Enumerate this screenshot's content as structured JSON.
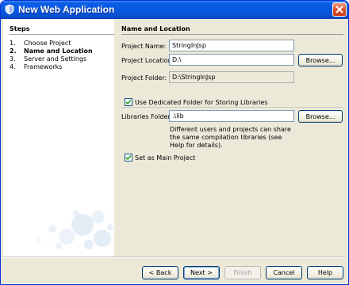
{
  "window": {
    "title": "New Web Application"
  },
  "steps": {
    "heading": "Steps",
    "items": [
      {
        "num": "1.",
        "label": "Choose Project"
      },
      {
        "num": "2.",
        "label": "Name and Location"
      },
      {
        "num": "3.",
        "label": "Server and Settings"
      },
      {
        "num": "4.",
        "label": "Frameworks"
      }
    ],
    "active_index": 1
  },
  "form": {
    "heading": "Name and Location",
    "project_name": {
      "label": "Project Name:",
      "value": "StringInJsp"
    },
    "project_location": {
      "label": "Project Location:",
      "value": "D:\\",
      "button": "Browse..."
    },
    "project_folder": {
      "label": "Project Folder:",
      "value": "D:\\StringInJsp"
    },
    "dedicated_folder": {
      "label": "Use Dedicated Folder for Storing Libraries",
      "checked": true
    },
    "libraries_folder": {
      "label": "Libraries Folder:",
      "value": ".\\lib",
      "button": "Browse..."
    },
    "note": "Different users and projects can share the same compilation libraries (see Help for details).",
    "main_project": {
      "label": "Set as Main Project",
      "checked": true
    }
  },
  "buttons": {
    "back": "< Back",
    "next": "Next >",
    "finish": "Finish",
    "cancel": "Cancel",
    "help": "Help"
  },
  "colors": {
    "titlebar": "#0558e0",
    "dialog_bg": "#ece9d8",
    "checkmark": "#21a121"
  }
}
